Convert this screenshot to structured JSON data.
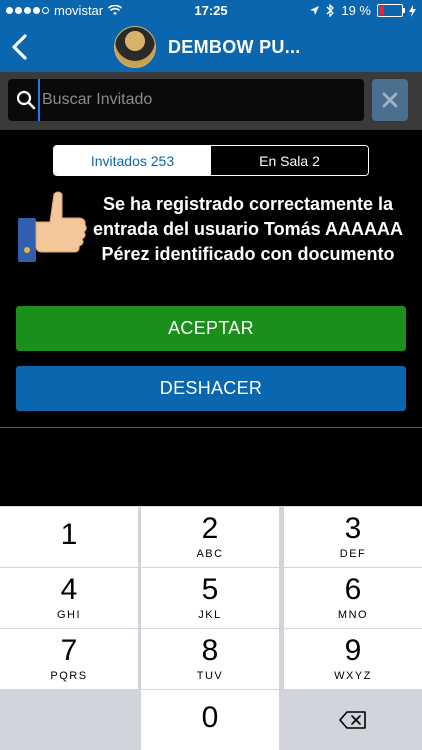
{
  "status_bar": {
    "carrier": "movistar",
    "time": "17:25",
    "battery": "19 %"
  },
  "nav": {
    "title": "DEMBOW PU..."
  },
  "search": {
    "placeholder": "Buscar Invitado",
    "value": ""
  },
  "tabs": [
    {
      "label": "Invitados 253",
      "active": true
    },
    {
      "label": "En Sala 2",
      "active": false
    }
  ],
  "message": "Se ha registrado correctamente la entrada del usuario Tomás AAAAAA Pérez identificado con documento",
  "buttons": {
    "accept": "ACEPTAR",
    "undo": "DESHACER"
  },
  "keypad": [
    {
      "num": "1",
      "letters": ""
    },
    {
      "num": "2",
      "letters": "ABC"
    },
    {
      "num": "3",
      "letters": "DEF"
    },
    {
      "num": "4",
      "letters": "GHI"
    },
    {
      "num": "5",
      "letters": "JKL"
    },
    {
      "num": "6",
      "letters": "MNO"
    },
    {
      "num": "7",
      "letters": "PQRS"
    },
    {
      "num": "8",
      "letters": "TUV"
    },
    {
      "num": "9",
      "letters": "WXYZ"
    },
    {
      "num": "0",
      "letters": ""
    }
  ],
  "icons": [
    "wifi-icon",
    "location-icon",
    "bluetooth-icon",
    "battery-icon",
    "back-icon",
    "search-icon",
    "clear-icon",
    "thumbs-up-icon",
    "delete-icon"
  ],
  "colors": {
    "primary": "#0b66b0",
    "accept": "#1a8f1a",
    "background": "#000000"
  }
}
